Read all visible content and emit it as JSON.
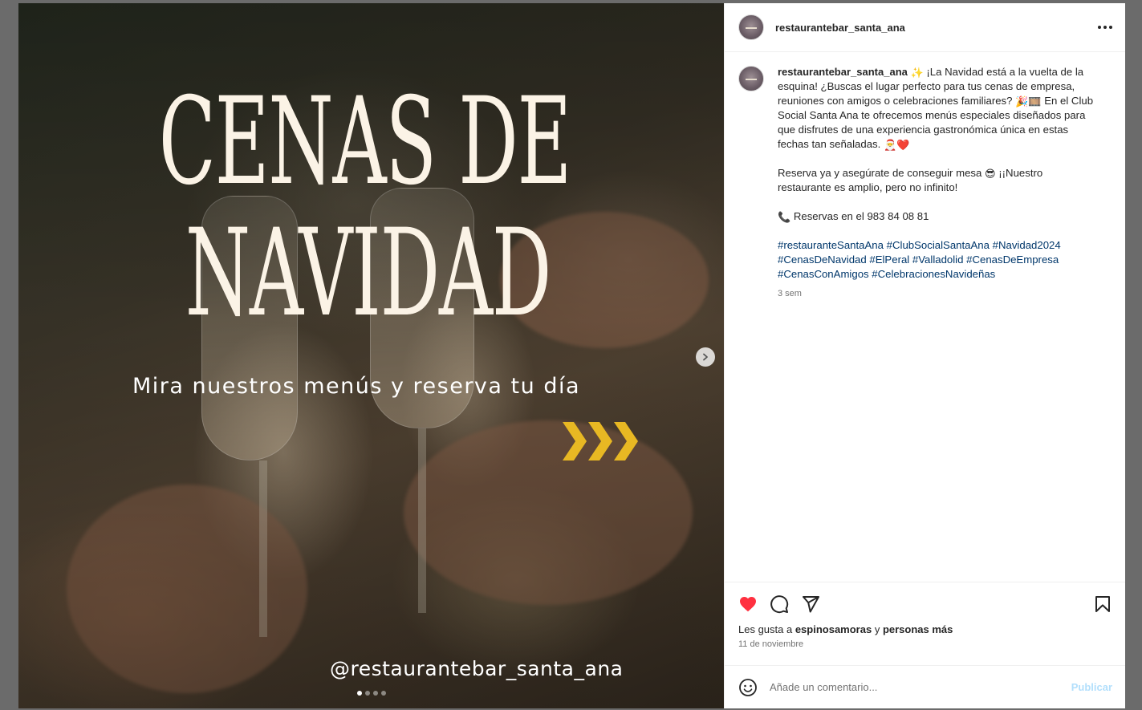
{
  "post": {
    "username": "restaurantebar_santa_ana",
    "media": {
      "headline_line1": "CENAS DE",
      "headline_line2": "NAVIDAD",
      "subtitle": "Mira nuestros menús y reserva tu día",
      "handle": "@restaurantebar_santa_ana",
      "carousel": {
        "count": 4,
        "active": 1
      },
      "chevron_color": "#e8b823"
    },
    "caption": {
      "p1_a": " ¡La Navidad está a la vuelta de la esquina! ¿Buscas el lugar perfecto para tus cenas de empresa, reuniones con amigos o celebraciones familiares? ",
      "p1_b": " En el Club Social Santa Ana te ofrecemos menús especiales diseñados para que disfrutes de una experiencia gastronómica única en estas fechas tan señaladas. ",
      "p2_a": "Reserva ya y asegúrate de conseguir mesa ",
      "p2_b": " ¡¡Nuestro restaurante es amplio, pero no infinito!",
      "p3": " Reservas en el 983 84 08 81",
      "hashtags": [
        "#restauranteSantaAna",
        "#ClubSocialSantaAna",
        "#Navidad2024",
        "#CenasDeNavidad",
        "#ElPeral",
        "#Valladolid",
        "#CenasDeEmpresa",
        "#CenasConAmigos",
        "#CelebracionesNavideñas"
      ],
      "emojis": {
        "sparkles": "✨",
        "party": "🎉",
        "film": "🎞️",
        "santa": "🎅",
        "heart": "❤️",
        "cool": "😎",
        "phone": "📞"
      },
      "time_ago": "3 sem"
    },
    "likes": {
      "prefix": "Les gusta a ",
      "user": "espinosamoras",
      "joiner": " y ",
      "others": "personas más"
    },
    "date": "11 de noviembre",
    "comment": {
      "placeholder": "Añade un comentario...",
      "publish_label": "Publicar"
    },
    "colors": {
      "like_red": "#ff3040",
      "hashtag_blue": "#00376b",
      "publish_disabled": "#b2dffc"
    }
  }
}
